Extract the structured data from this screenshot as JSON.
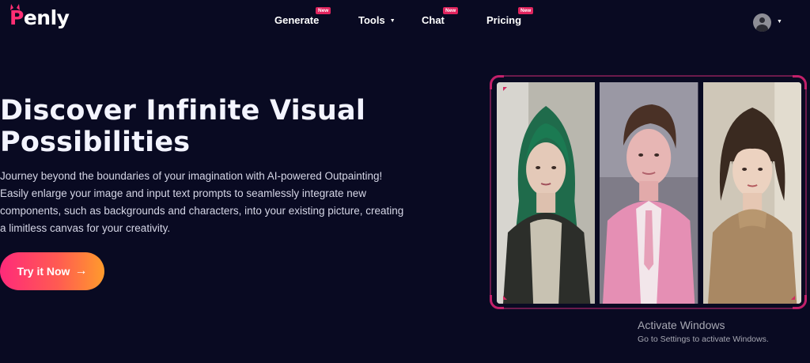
{
  "brand": {
    "logo_text": "enly",
    "logo_initial": "P",
    "accent": "#ff2e73"
  },
  "nav": {
    "generate": {
      "label": "Generate",
      "badge": "New"
    },
    "tools": {
      "label": "Tools"
    },
    "chat": {
      "label": "Chat",
      "badge": "New"
    },
    "pricing": {
      "label": "Pricing",
      "badge": "New"
    }
  },
  "user": {
    "avatar_icon": "user-icon",
    "menu_icon": "caret-down-icon"
  },
  "hero": {
    "title_line1": "Discover Infinite Visual",
    "title_line2": "Possibilities",
    "description": "Journey beyond the boundaries of your imagination with AI-powered Outpainting! Easily enlarge your image and input text prompts to seamlessly integrate new components, such as backgrounds and characters, into your existing picture, creating a limitless canvas for your creativity.",
    "cta_label": "Try it Now",
    "cta_arrow": "→"
  },
  "showcase": {
    "panels": [
      "woman-green-hair",
      "man-pink-suit",
      "woman-bob-sweater"
    ]
  },
  "os_watermark": {
    "title": "Activate Windows",
    "subtitle": "Go to Settings to activate Windows."
  },
  "colors": {
    "background": "#090a22",
    "cta_start": "#ff2a7a",
    "cta_end": "#ff9b2c",
    "frame": "#6b1a4c",
    "badge": "#e0245e"
  }
}
